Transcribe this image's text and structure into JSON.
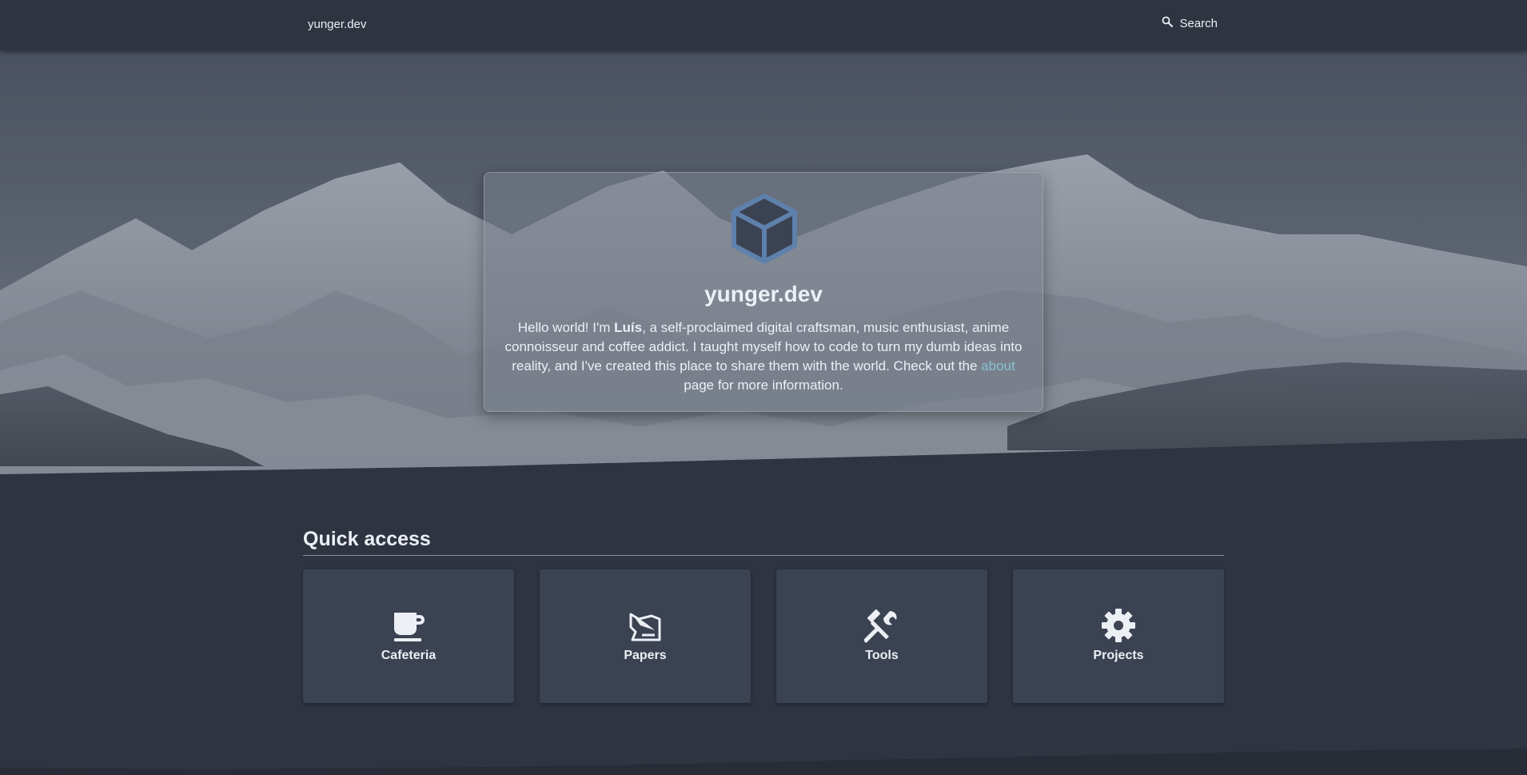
{
  "header": {
    "brand": "yunger.dev",
    "search_label": "Search",
    "icons": {
      "search": "search-icon"
    }
  },
  "hero": {
    "logo_icon": "cube-icon",
    "title": "yunger.dev",
    "intro_before": "Hello world! I'm ",
    "intro_name": "Luís",
    "intro_middle": ", a self-proclaimed digital craftsman, music enthusiast, anime connoisseur and coffee addict. I taught myself how to code to turn my dumb ideas into reality, and I've created this place to share them with the world. Check out the ",
    "intro_link": "about",
    "intro_after": " page for more information."
  },
  "quick_access": {
    "title": "Quick access",
    "tiles": [
      {
        "label": "Cafeteria",
        "icon": "coffee-cup-icon"
      },
      {
        "label": "Papers",
        "icon": "paper-plane-icon"
      },
      {
        "label": "Tools",
        "icon": "tools-icon"
      },
      {
        "label": "Projects",
        "icon": "gear-icon"
      }
    ]
  },
  "colors": {
    "background": "#2e3440",
    "tile": "#3b4252",
    "text": "#eceff4",
    "link": "#88c0d0",
    "logo_accent": "#5e81ac"
  }
}
